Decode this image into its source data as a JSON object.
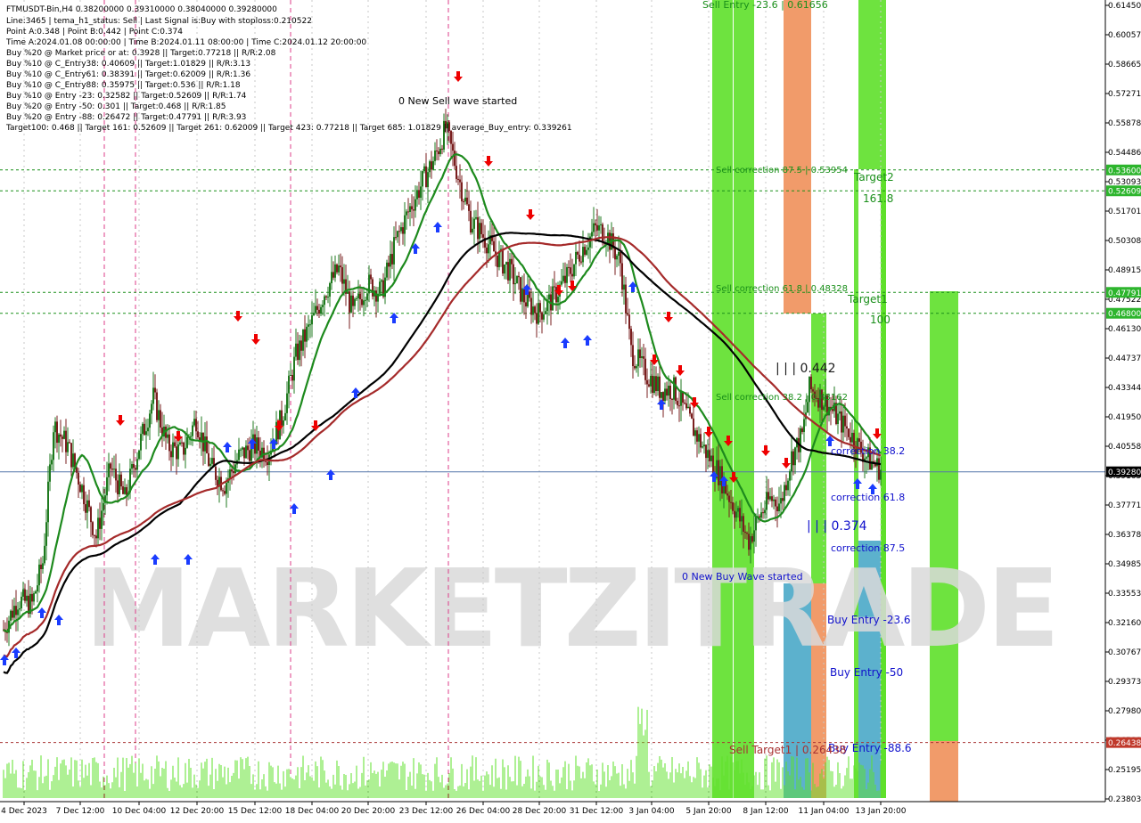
{
  "chart_data": {
    "type": "candlestick",
    "title": "FTMUSDT-Bin,H4  0.38200000 0.39310000 0.38040000 0.39280000",
    "info_lines": [
      "Line:3465 | tema_h1_status: Sell | Last Signal is:Buy with stoploss:0.210522",
      "Point A:0.348 | Point B:0.442 | Point C:0.374",
      "Time A:2024.01.08 00:00:00 | Time B:2024.01.11 08:00:00 | Time C:2024.01.12 20:00:00",
      "Buy %20 @ Market price or at: 0.3928 || Target:0.77218 || R/R:2.08",
      "Buy %10 @ C_Entry38: 0.40609 || Target:1.01829 || R/R:3.13",
      "Buy %10 @ C_Entry61: 0.38391 || Target:0.62009 || R/R:1.36",
      "Buy %10 @ C_Entry88: 0.35975 || Target:0.536 || R/R:1.18",
      "Buy %10 @ Entry -23: 0.32582 || Target:0.52609 || R/R:1.74",
      "Buy %20 @ Entry -50: 0.301 || Target:0.468 || R/R:1.85",
      "Buy %20 @ Entry -88: 0.26472 || Target:0.47791 || R/R:3.93",
      "Target100: 0.468 || Target 161: 0.52609 || Target 261: 0.62009 || Target 423: 0.77218 || Target 685: 1.01829 || average_Buy_entry: 0.339261"
    ],
    "y_ticks": [
      "0.61450",
      "0.60057",
      "0.58665",
      "0.57271",
      "0.55878",
      "0.54486",
      "0.53093",
      "0.51701",
      "0.50308",
      "0.48915",
      "0.47522",
      "0.46130",
      "0.44737",
      "0.43344",
      "0.41950",
      "0.40558",
      "0.39165",
      "0.37771",
      "0.36378",
      "0.34985",
      "0.33553",
      "0.32160",
      "0.30767",
      "0.29373",
      "0.27980",
      "0.26588",
      "0.25195",
      "0.23803"
    ],
    "x_ticks": [
      "4 Dec 2023",
      "7 Dec 12:00",
      "10 Dec 04:00",
      "12 Dec 20:00",
      "15 Dec 12:00",
      "18 Dec 04:00",
      "20 Dec 20:00",
      "23 Dec 12:00",
      "26 Dec 04:00",
      "28 Dec 20:00",
      "31 Dec 12:00",
      "3 Jan 04:00",
      "5 Jan 20:00",
      "8 Jan 12:00",
      "11 Jan 04:00",
      "13 Jan 20:00"
    ],
    "ylim": [
      0.23803,
      0.6145
    ],
    "current_price": "0.39280",
    "level_boxes": [
      {
        "label": "0.53600",
        "value": 0.536,
        "color": "#2db52d"
      },
      {
        "label": "0.52609",
        "value": 0.52609,
        "color": "#2db52d"
      },
      {
        "label": "0.47791",
        "value": 0.47791,
        "color": "#2db52d"
      },
      {
        "label": "0.46800",
        "value": 0.468,
        "color": "#2db52d"
      },
      {
        "label": "0.26438",
        "value": 0.26438,
        "color": "#c0392b"
      }
    ],
    "h_levels": [
      {
        "value": 0.536,
        "color": "#1a8f1a"
      },
      {
        "value": 0.52609,
        "color": "#1a8f1a"
      },
      {
        "value": 0.47791,
        "color": "#1a8f1a"
      },
      {
        "value": 0.468,
        "color": "#1a8f1a"
      },
      {
        "value": 0.26438,
        "color": "#a83232"
      }
    ],
    "annotations": [
      {
        "text": "0 New Sell wave started",
        "color": "#000000"
      },
      {
        "text": "0 New Buy Wave started",
        "color": "#1010cc"
      },
      {
        "text": "Sell Entry -23.6 | 0.61656",
        "color": "#1a8f1a"
      },
      {
        "text": "Sell correction 87.5 | 0.53954",
        "color": "#1a8f1a"
      },
      {
        "text": "Sell correction 61.8 | 0.48328",
        "color": "#1a8f1a"
      },
      {
        "text": "Sell correction 38.2 | 0.43162",
        "color": "#1a8f1a"
      },
      {
        "text": "Target2",
        "color": "#1a8f1a"
      },
      {
        "text": "161.8",
        "color": "#1a8f1a"
      },
      {
        "text": "Target1",
        "color": "#1a8f1a"
      },
      {
        "text": "100",
        "color": "#1a8f1a"
      },
      {
        "text": "| | | 0.442",
        "color": "#1a1a1a"
      },
      {
        "text": "| | | 0.374",
        "color": "#1010cc"
      },
      {
        "text": "correction 38.2",
        "color": "#1010cc"
      },
      {
        "text": "correction 61.8",
        "color": "#1010cc"
      },
      {
        "text": "correction 87.5",
        "color": "#1010cc"
      },
      {
        "text": "Buy Entry -23.6",
        "color": "#1010cc"
      },
      {
        "text": "Buy Entry -50",
        "color": "#1010cc"
      },
      {
        "text": "Buy Entry -88.6",
        "color": "#1010cc"
      },
      {
        "text": "Sell Target1 | 0.26438",
        "color": "#a83232"
      }
    ],
    "watermark": "MARKETZITRADE",
    "colors": {
      "bull": "#1f7a1f",
      "bear": "#7a1f1f",
      "green_ma": "#1d8a1d",
      "black_ma": "#000000",
      "red_ma": "#a52a2a",
      "zone_green": "#5ee02a",
      "zone_orange": "#f0905a",
      "zone_blue": "#4aa8c8",
      "buy_arrow": "#1a3cff",
      "sell_arrow": "#ee0000",
      "price_line": "#5577aa"
    }
  }
}
